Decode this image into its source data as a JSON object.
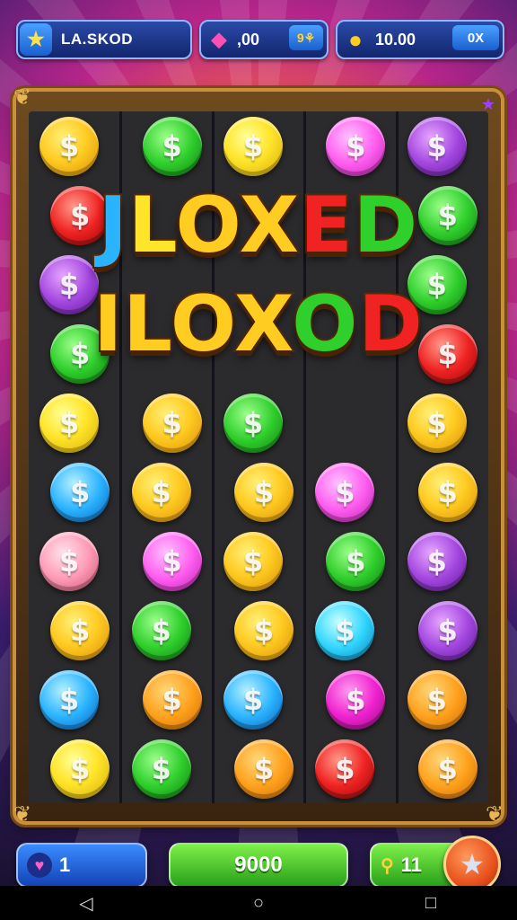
{
  "top_bar": {
    "player_name": "LA.SKOD",
    "player_icon": "star-icon",
    "gems_value": ",00",
    "gems_icon": "gem-icon",
    "gems_mini_label": "9⚘",
    "coins_value": "10.00",
    "coins_icon": "coin-stack-icon",
    "coins_mini_label": "0X"
  },
  "title": {
    "line1": [
      "J",
      "L",
      "O",
      "X",
      "E",
      "D"
    ],
    "line1_colors": [
      "#2ab4ff",
      "#ffe52a",
      "#ffcc22",
      "#ffcc22",
      "#f02222",
      "#2fcf2c"
    ],
    "line2": [
      "I",
      "L",
      "O",
      "X",
      "O",
      "D"
    ],
    "line2_colors": [
      "#ffcc22",
      "#ffcc22",
      "#ffcc22",
      "#ffcc22",
      "#2fcf2c",
      "#f02222"
    ]
  },
  "board": {
    "coin_symbol": "$",
    "columns": 5,
    "coins": [
      [
        "gold",
        "green",
        "yellow",
        "pink",
        "purple"
      ],
      [
        "red",
        "",
        "",
        "",
        "green"
      ],
      [
        "purple",
        "",
        "",
        "",
        "green"
      ],
      [
        "green",
        "",
        "",
        "",
        "red"
      ],
      [
        "yellow",
        "gold",
        "green",
        "",
        "gold"
      ],
      [
        "blue",
        "gold",
        "gold",
        "pink",
        "gold"
      ],
      [
        "peach",
        "pink",
        "gold",
        "green",
        "purple"
      ],
      [
        "gold",
        "green",
        "gold",
        "cyan",
        "purple"
      ],
      [
        "blue",
        "orange",
        "blue",
        "magenta",
        "orange"
      ],
      [
        "yellow",
        "green",
        "orange",
        "red",
        "orange"
      ]
    ]
  },
  "bottom_bar": {
    "lives_value": "1",
    "lives_icon": "heart-gem-icon",
    "score_value": "9000",
    "key_value": "11",
    "key_icon": "key-icon",
    "star_button_icon": "star-icon"
  },
  "nav": {
    "back_glyph": "◁",
    "home_glyph": "○",
    "recent_glyph": "□"
  }
}
